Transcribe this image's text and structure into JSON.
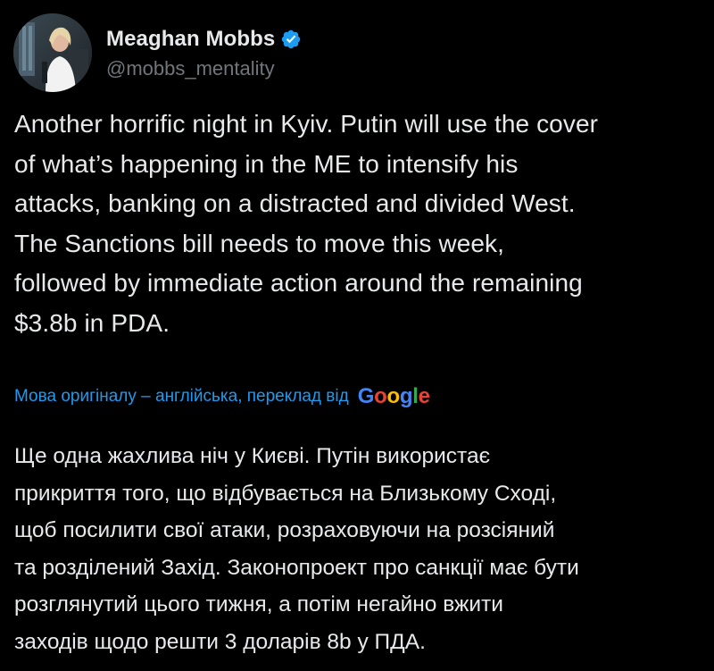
{
  "author": {
    "display_name": "Meaghan Mobbs",
    "handle": "@mobbs_mentality",
    "verified_icon": "verified-badge-icon",
    "avatar": "profile-avatar"
  },
  "tweet": {
    "text": "Another horrific night in Kyiv. Putin will use the cover\nof what’s happening in the ME to intensify his\nattacks, banking on a distracted and divided West.\nThe Sanctions bill needs to move this week,\nfollowed by immediate action around the remaining\n$3.8b in PDA."
  },
  "translation": {
    "label": "Мова оригіналу – англійська, переклад від",
    "provider_letters": [
      "G",
      "o",
      "o",
      "g",
      "l",
      "e"
    ],
    "text": "Ще одна жахлива ніч у Києві. Путін використає\nприкриття того, що відбувається на Близькому Сході,\nщоб посилити свої атаки, розраховуючи на розсіяний\nта розділений Захід. Законопроект про санкції має бути\nрозглянутий цього тижня, а потім негайно вжити\nзаходів щодо решти 3 доларів 8b у ПДА."
  },
  "colors": {
    "background": "#000000",
    "text": "#e7e9ea",
    "secondary": "#71767b",
    "link": "#1d9bf0",
    "verified": "#1d9bf0",
    "google_blue": "#4285f4",
    "google_red": "#ea4335",
    "google_yellow": "#fbbc05",
    "google_green": "#34a853"
  }
}
